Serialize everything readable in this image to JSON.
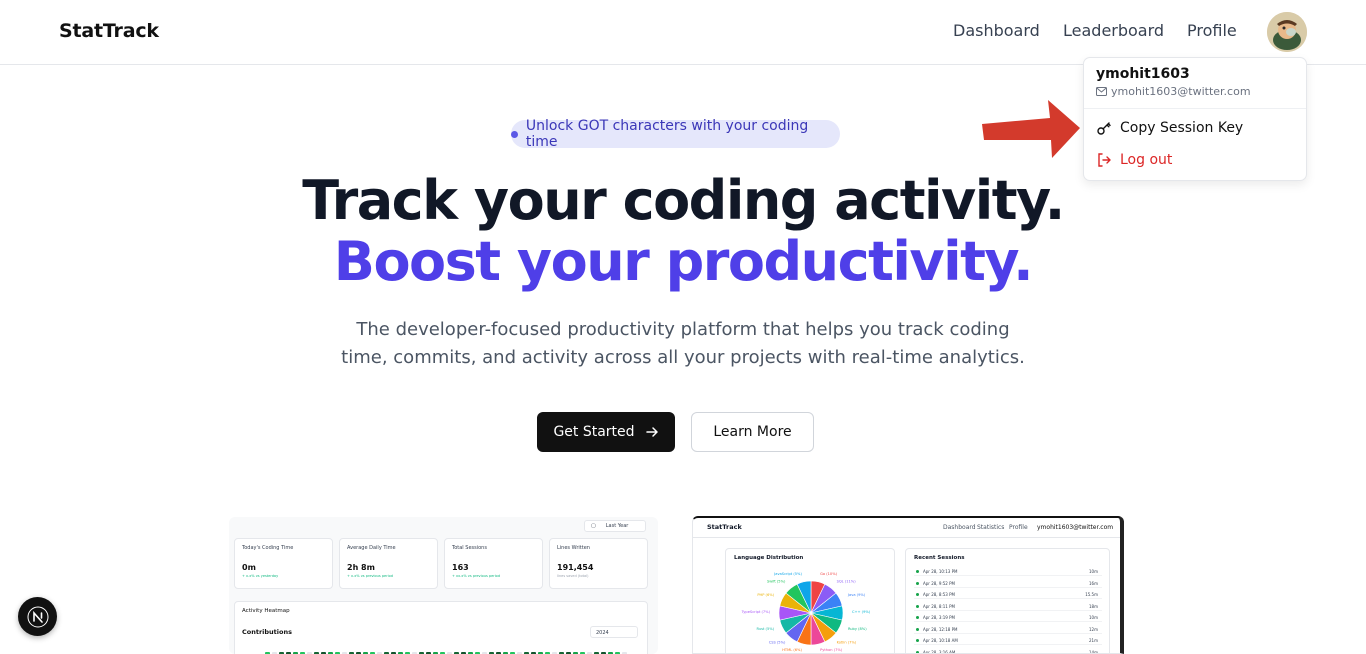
{
  "header": {
    "logo": "StatTrack",
    "nav": [
      "Dashboard",
      "Leaderboard",
      "Profile"
    ]
  },
  "dropdown": {
    "username": "ymohit1603",
    "email": "ymohit1603@twitter.com",
    "copy_label": "Copy Session Key",
    "logout_label": "Log out"
  },
  "hero": {
    "badge": "Unlock GOT characters with your coding time",
    "title_line1": "Track your coding activity.",
    "title_line2": "Boost your productivity.",
    "subtitle_line1": "The developer-focused productivity platform that helps you track coding",
    "subtitle_line2": "time, commits, and activity across all your projects with real-time analytics.",
    "primary_button": "Get Started",
    "secondary_button": "Learn More"
  },
  "preview1": {
    "range": "Last Year",
    "cards": [
      {
        "title": "Today's Coding Time",
        "value": "0m",
        "note": "+ x.x% vs yesterday"
      },
      {
        "title": "Average Daily Time",
        "value": "2h 8m",
        "note": "+ x.x% vs previous period"
      },
      {
        "title": "Total Sessions",
        "value": "163",
        "note": "+ xx.x% vs previous period"
      },
      {
        "title": "Lines Written",
        "value": "191,454",
        "note": "lines saved (total)"
      }
    ],
    "heatmap_title": "Activity Heatmap",
    "contributions": "Contributions",
    "year": "2024"
  },
  "preview2": {
    "logo": "StatTrack",
    "nav": [
      "Dashboard",
      "Statistics",
      "Profile"
    ],
    "account": "ymohit1603@twitter.com",
    "lang_title": "Language Distribution",
    "sessions_title": "Recent Sessions",
    "sessions": [
      {
        "date": "Apr 28, 10:13 PM",
        "dur": "10m"
      },
      {
        "date": "Apr 28, 9:52 PM",
        "dur": "16m"
      },
      {
        "date": "Apr 28, 8:53 PM",
        "dur": "15.5m"
      },
      {
        "date": "Apr 28, 8:11 PM",
        "dur": "18m"
      },
      {
        "date": "Apr 28, 3:19 PM",
        "dur": "10m"
      },
      {
        "date": "Apr 28, 12:18 PM",
        "dur": "12m"
      },
      {
        "date": "Apr 28, 10:18 AM",
        "dur": "21m"
      },
      {
        "date": "Apr 28, 3:16 AM",
        "dur": "14m"
      }
    ],
    "pie_labels": [
      "Go (10%)",
      "SQL (11%)",
      "Java (9%)",
      "C++ (9%)",
      "Ruby (8%)",
      "Kotlin (7%)",
      "Python (7%)",
      "HTML (6%)",
      "CSS (5%)",
      "Rust (5%)",
      "TypeScript (7%)",
      "PHP (6%)",
      "Swift (5%)",
      "JavaScript (5%)"
    ]
  },
  "colors": {
    "accent": "#4f46e5",
    "arrow": "#d33a2c",
    "logout": "#dc2626"
  }
}
